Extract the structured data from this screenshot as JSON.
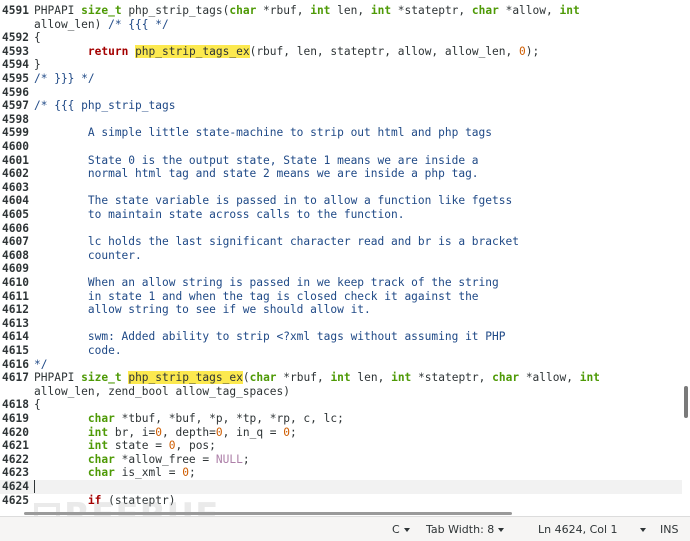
{
  "editor": {
    "lines": [
      {
        "n": "4591",
        "code": [
          [
            "PHPAPI ",
            ""
          ],
          [
            "size_t",
            "ty"
          ],
          [
            " php_strip_tags(",
            ""
          ],
          [
            "char",
            "ty"
          ],
          [
            " *rbuf, ",
            ""
          ],
          [
            "int",
            "ty"
          ],
          [
            " len, ",
            ""
          ],
          [
            "int",
            "ty"
          ],
          [
            " *stateptr, ",
            ""
          ],
          [
            "char",
            "ty"
          ],
          [
            " *allow, ",
            ""
          ],
          [
            "int",
            "ty"
          ]
        ]
      },
      {
        "n": "",
        "code": [
          [
            "allow_len) ",
            ""
          ],
          [
            "/* {{{ */",
            "cm"
          ]
        ]
      },
      {
        "n": "4592",
        "code": [
          [
            "{",
            ""
          ]
        ]
      },
      {
        "n": "4593",
        "code": [
          [
            "        ",
            ""
          ],
          [
            "return",
            "kw"
          ],
          [
            " ",
            ""
          ],
          [
            "php_strip_tags_ex",
            "hl"
          ],
          [
            "(rbuf, len, stateptr, allow, allow_len, ",
            ""
          ],
          [
            "0",
            "num"
          ],
          [
            ");",
            ""
          ]
        ]
      },
      {
        "n": "4594",
        "code": [
          [
            "}",
            ""
          ]
        ]
      },
      {
        "n": "4595",
        "code": [
          [
            "/* }}} */",
            "cm"
          ]
        ]
      },
      {
        "n": "4596",
        "code": []
      },
      {
        "n": "4597",
        "code": [
          [
            "/* {{{ php_strip_tags",
            "cm"
          ]
        ]
      },
      {
        "n": "4598",
        "code": []
      },
      {
        "n": "4599",
        "code": [
          [
            "        A simple little state-machine to strip out html and php tags",
            "cm"
          ]
        ]
      },
      {
        "n": "4600",
        "code": []
      },
      {
        "n": "4601",
        "code": [
          [
            "        State 0 is the output state, State 1 means we are inside a",
            "cm"
          ]
        ]
      },
      {
        "n": "4602",
        "code": [
          [
            "        normal html tag and state 2 means we are inside a php tag.",
            "cm"
          ]
        ]
      },
      {
        "n": "4603",
        "code": []
      },
      {
        "n": "4604",
        "code": [
          [
            "        The state variable is passed in to allow a function like fgetss",
            "cm"
          ]
        ]
      },
      {
        "n": "4605",
        "code": [
          [
            "        to maintain state across calls to the function.",
            "cm"
          ]
        ]
      },
      {
        "n": "4606",
        "code": []
      },
      {
        "n": "4607",
        "code": [
          [
            "        lc holds the last significant character read and br is a bracket",
            "cm"
          ]
        ]
      },
      {
        "n": "4608",
        "code": [
          [
            "        counter.",
            "cm"
          ]
        ]
      },
      {
        "n": "4609",
        "code": []
      },
      {
        "n": "4610",
        "code": [
          [
            "        When an allow string is passed in we keep track of the string",
            "cm"
          ]
        ]
      },
      {
        "n": "4611",
        "code": [
          [
            "        in state 1 and when the tag is closed check it against the",
            "cm"
          ]
        ]
      },
      {
        "n": "4612",
        "code": [
          [
            "        allow string to see if we should allow it.",
            "cm"
          ]
        ]
      },
      {
        "n": "4613",
        "code": []
      },
      {
        "n": "4614",
        "code": [
          [
            "        swm: Added ability to strip <?xml tags without assuming it PHP",
            "cm"
          ]
        ]
      },
      {
        "n": "4615",
        "code": [
          [
            "        code.",
            "cm"
          ]
        ]
      },
      {
        "n": "4616",
        "code": [
          [
            "*/",
            "cm"
          ]
        ]
      },
      {
        "n": "4617",
        "code": [
          [
            "PHPAPI ",
            ""
          ],
          [
            "size_t",
            "ty"
          ],
          [
            " ",
            ""
          ],
          [
            "php_strip_tags_ex",
            "hl"
          ],
          [
            "(",
            ""
          ],
          [
            "char",
            "ty"
          ],
          [
            " *rbuf, ",
            ""
          ],
          [
            "int",
            "ty"
          ],
          [
            " len, ",
            ""
          ],
          [
            "int",
            "ty"
          ],
          [
            " *stateptr, ",
            ""
          ],
          [
            "char",
            "ty"
          ],
          [
            " *allow, ",
            ""
          ],
          [
            "int",
            "ty"
          ]
        ]
      },
      {
        "n": "",
        "code": [
          [
            "allow_len, zend_bool allow_tag_spaces)",
            ""
          ]
        ]
      },
      {
        "n": "4618",
        "code": [
          [
            "{",
            ""
          ]
        ]
      },
      {
        "n": "4619",
        "code": [
          [
            "        ",
            ""
          ],
          [
            "char",
            "ty"
          ],
          [
            " *tbuf, *buf, *p, *tp, *rp, c, lc;",
            ""
          ]
        ]
      },
      {
        "n": "4620",
        "code": [
          [
            "        ",
            ""
          ],
          [
            "int",
            "ty"
          ],
          [
            " br, i=",
            ""
          ],
          [
            "0",
            "num"
          ],
          [
            ", depth=",
            ""
          ],
          [
            "0",
            "num"
          ],
          [
            ", in_q = ",
            ""
          ],
          [
            "0",
            "num"
          ],
          [
            ";",
            ""
          ]
        ]
      },
      {
        "n": "4621",
        "code": [
          [
            "        ",
            ""
          ],
          [
            "int",
            "ty"
          ],
          [
            " state = ",
            ""
          ],
          [
            "0",
            "num"
          ],
          [
            ", pos;",
            ""
          ]
        ]
      },
      {
        "n": "4622",
        "code": [
          [
            "        ",
            ""
          ],
          [
            "char",
            "ty"
          ],
          [
            " *allow_free = ",
            ""
          ],
          [
            "NULL",
            "nl"
          ],
          [
            ";",
            ""
          ]
        ]
      },
      {
        "n": "4623",
        "code": [
          [
            "        ",
            ""
          ],
          [
            "char",
            "ty"
          ],
          [
            " is_xml = ",
            ""
          ],
          [
            "0",
            "num"
          ],
          [
            ";",
            ""
          ]
        ]
      },
      {
        "n": "4624",
        "code": [],
        "current": true
      },
      {
        "n": "4625",
        "code": [
          [
            "        ",
            ""
          ],
          [
            "if",
            "kw"
          ],
          [
            " (stateptr)",
            ""
          ]
        ]
      }
    ]
  },
  "statusbar": {
    "language": "C",
    "tab_width": "Tab Width: 8",
    "position": "Ln 4624, Col 1",
    "mode": "INS"
  },
  "watermark": "REEBUF",
  "colors": {
    "keyword": "#a40000",
    "type": "#4e9a06",
    "comment": "#204a87",
    "number": "#ce5c00",
    "null": "#ad7fa8",
    "highlight": "#fce94f"
  }
}
